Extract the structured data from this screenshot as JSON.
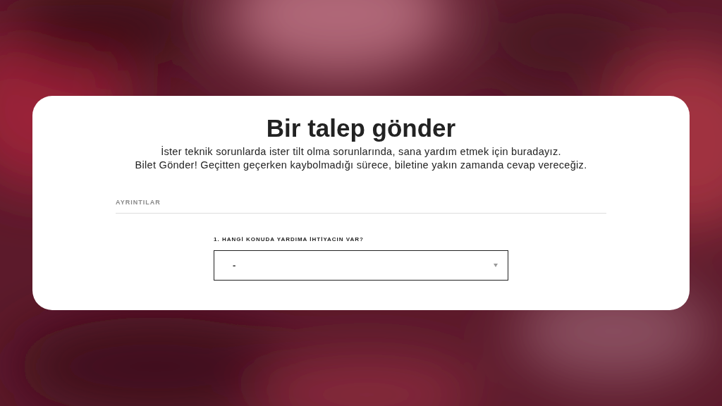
{
  "card": {
    "title": "Bir talep gönder",
    "intro": [
      "İster teknik sorunlarda ister tilt olma sorunlarında, sana yardım etmek için buradayız.",
      "Bilet Gönder! Geçitten geçerken kaybolmadığı sürece, biletine yakın zamanda cevap vereceğiz."
    ],
    "section": "AYRINTILAR",
    "question": {
      "label": "1. HANGİ KONUDA YARDIMA İHTİYACIN VAR?",
      "value": "-"
    }
  }
}
